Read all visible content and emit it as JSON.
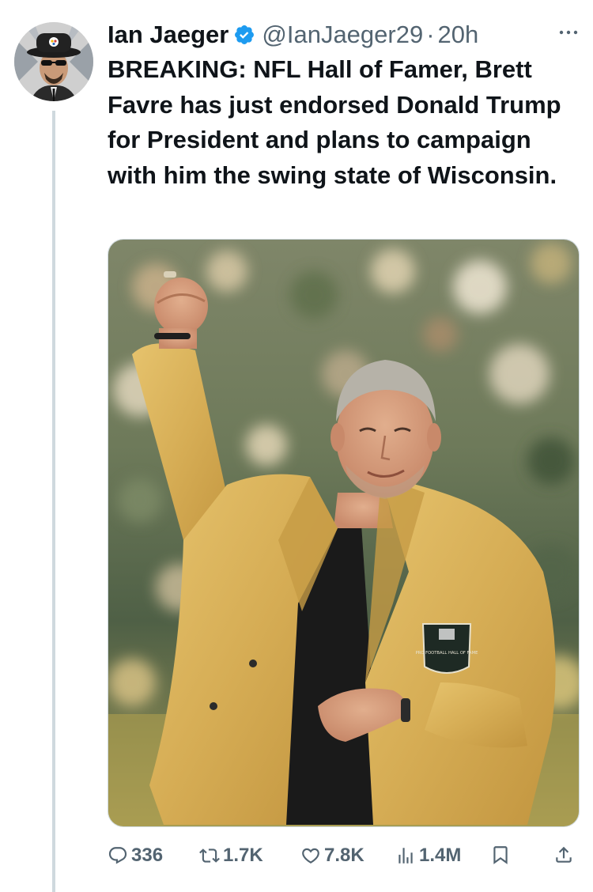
{
  "tweet": {
    "author": {
      "display_name": "Ian Jaeger",
      "handle": "@IanJaeger29",
      "verified": true,
      "separator": "·",
      "time": "20h"
    },
    "text": "BREAKING: NFL Hall of Famer, Brett Favre has just endorsed Donald Trump for President and plans to campaign with him the swing state of Wisconsin.",
    "media": {
      "jacket_patch_text": "PRO FOOTBALL HALL OF FAME"
    },
    "actions": {
      "replies": "336",
      "reposts": "1.7K",
      "likes": "7.8K",
      "views": "1.4M"
    },
    "icons": {
      "reply": "reply-icon",
      "repost": "repost-icon",
      "like": "heart-icon",
      "views": "views-icon",
      "bookmark": "bookmark-icon",
      "share": "share-icon",
      "more": "more-icon",
      "verified": "verified-badge-icon"
    },
    "colors": {
      "text_primary": "#0f1419",
      "text_secondary": "#536471",
      "verified_blue": "#1d9bf0",
      "jacket_gold": "#d8b257"
    }
  }
}
